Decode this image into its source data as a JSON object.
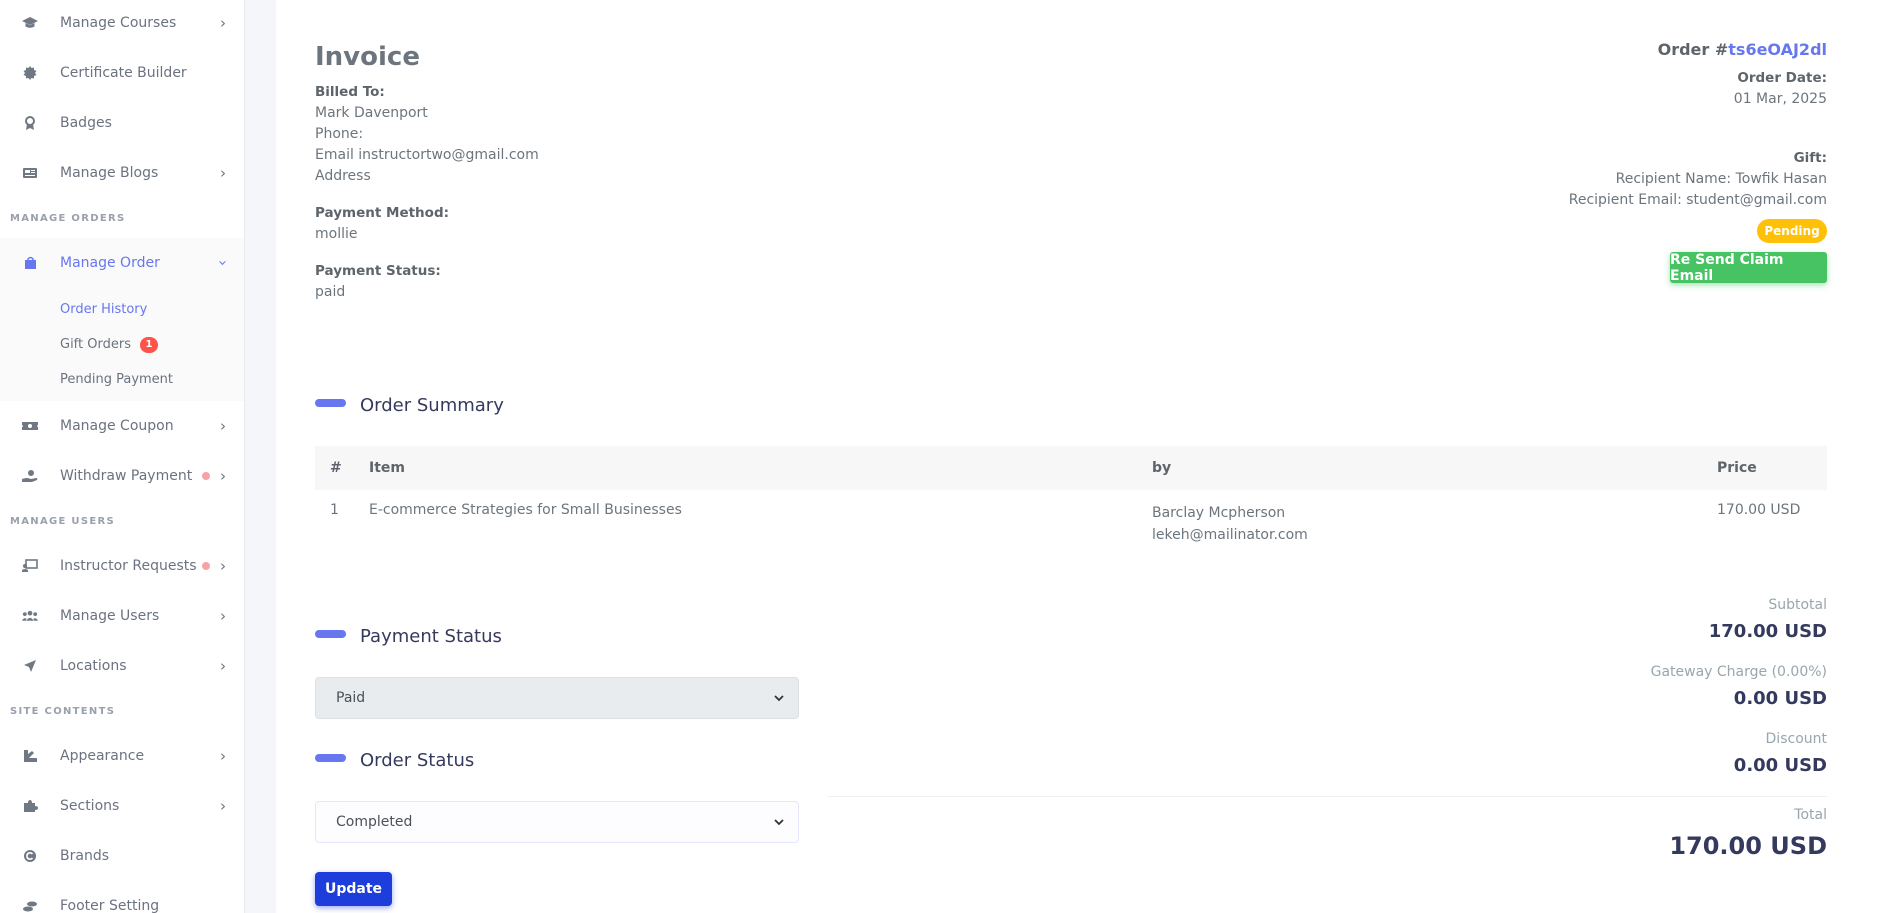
{
  "sidebar": {
    "items_top": [
      {
        "label": "Manage Courses",
        "icon": "graduation-cap-icon",
        "chevron": true
      },
      {
        "label": "Certificate Builder",
        "icon": "certificate-icon",
        "chevron": false
      },
      {
        "label": "Badges",
        "icon": "award-icon",
        "chevron": false
      },
      {
        "label": "Manage Blogs",
        "icon": "newspaper-icon",
        "chevron": true
      }
    ],
    "section_orders": "MANAGE ORDERS",
    "manage_order": "Manage Order",
    "sub_items": [
      {
        "label": "Order History"
      },
      {
        "label": "Gift Orders",
        "badge": "1"
      },
      {
        "label": "Pending Payment"
      }
    ],
    "manage_coupon": "Manage Coupon",
    "withdraw_payment": "Withdraw Payment",
    "section_users": "MANAGE USERS",
    "instructor_requests": "Instructor Requests",
    "manage_users": "Manage Users",
    "locations": "Locations",
    "section_contents": "SITE CONTENTS",
    "appearance": "Appearance",
    "sections": "Sections",
    "brands": "Brands",
    "footer_setting": "Footer Setting"
  },
  "invoice": {
    "title": "Invoice",
    "billed_to_label": "Billed To:",
    "billed_name": "Mark Davenport",
    "phone": "Phone:",
    "email": "Email instructortwo@gmail.com",
    "address": "Address",
    "payment_method_label": "Payment Method:",
    "payment_method": "mollie",
    "payment_status_label": "Payment Status:",
    "payment_status": "paid",
    "order_prefix": "Order #",
    "order_id": "ts6eOAJ2dl",
    "order_date_label": "Order Date:",
    "order_date": "01 Mar, 2025",
    "gift_label": "Gift:",
    "recipient_name": "Recipient Name: Towfik Hasan",
    "recipient_email": "Recipient Email: student@gmail.com",
    "status_pill": "Pending",
    "resend_button": "Re Send Claim Email"
  },
  "order_summary": {
    "title": "Order Summary",
    "headers": {
      "num": "#",
      "item": "Item",
      "by": "by",
      "price": "Price"
    },
    "rows": [
      {
        "num": "1",
        "item": "E-commerce Strategies for Small Businesses",
        "by_name": "Barclay Mcpherson",
        "by_email": "lekeh@mailinator.com",
        "price": "170.00 USD"
      }
    ]
  },
  "payment_status": {
    "title": "Payment Status",
    "selected": "Paid"
  },
  "order_status": {
    "title": "Order Status",
    "selected": "Completed"
  },
  "update_button": "Update",
  "totals": {
    "subtotal_label": "Subtotal",
    "subtotal": "170.00 USD",
    "gateway_label": "Gateway Charge (0.00%)",
    "gateway": "0.00 USD",
    "discount_label": "Discount",
    "discount": "0.00 USD",
    "total_label": "Total",
    "total": "170.00 USD"
  },
  "colors": {
    "accent": "#6777ef",
    "warning": "#ffc107",
    "success": "#47c363",
    "primary_button": "#1e3edb",
    "danger": "#fc544b"
  }
}
